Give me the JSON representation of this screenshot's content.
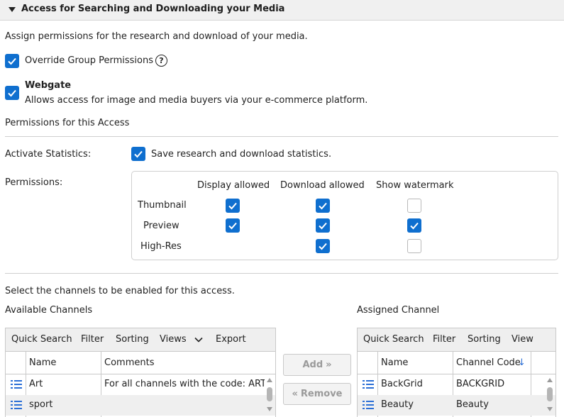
{
  "section": {
    "title": "Access for Searching and Downloading your Media",
    "description": "Assign permissions for the research and download of your media."
  },
  "override": {
    "label": "Override Group Permissions",
    "checked": true,
    "help_icon": "help-circle-icon"
  },
  "webgate": {
    "title": "Webgate",
    "description": "Allows access for image and media buyers via your e-commerce platform.",
    "checked": true
  },
  "permissions_heading": "Permissions for this Access",
  "statistics": {
    "label": "Activate Statistics:",
    "checkbox_label": "Save research and download statistics.",
    "checked": true
  },
  "permissions": {
    "label": "Permissions:",
    "columns": [
      "Display allowed",
      "Download allowed",
      "Show watermark"
    ],
    "rows": [
      {
        "label": "Thumbnail",
        "display": true,
        "download": true,
        "watermark": false
      },
      {
        "label": "Preview",
        "display": true,
        "download": true,
        "watermark": true
      },
      {
        "label": "High-Res",
        "display": null,
        "download": true,
        "watermark": false
      }
    ]
  },
  "channels": {
    "instruction": "Select the channels to be enabled for this access.",
    "available_title": "Available Channels",
    "assigned_title": "Assigned Channel",
    "available": {
      "toolbar": [
        "Quick Search",
        "Filter",
        "Sorting",
        "Views",
        "Export"
      ],
      "columns": [
        "Name",
        "Comments"
      ],
      "rows": [
        {
          "name": "Art",
          "comment": "For all channels with the code: ART"
        },
        {
          "name": "sport",
          "comment": ""
        }
      ]
    },
    "assigned": {
      "toolbar": [
        "Quick Search",
        "Filter",
        "Sorting",
        "View"
      ],
      "columns": [
        "Name",
        "Channel Code"
      ],
      "sort_indicator": "↓",
      "rows": [
        {
          "name": "BackGrid",
          "code": "BACKGRID"
        },
        {
          "name": "Beauty",
          "code": "Beauty"
        }
      ]
    },
    "add_label": "Add",
    "remove_label": "Remove"
  },
  "colors": {
    "accent": "#0f6fcf",
    "header_bg": "#f0f0f0",
    "border": "#cfcfcf",
    "list_icon": "#2b6fd6"
  }
}
